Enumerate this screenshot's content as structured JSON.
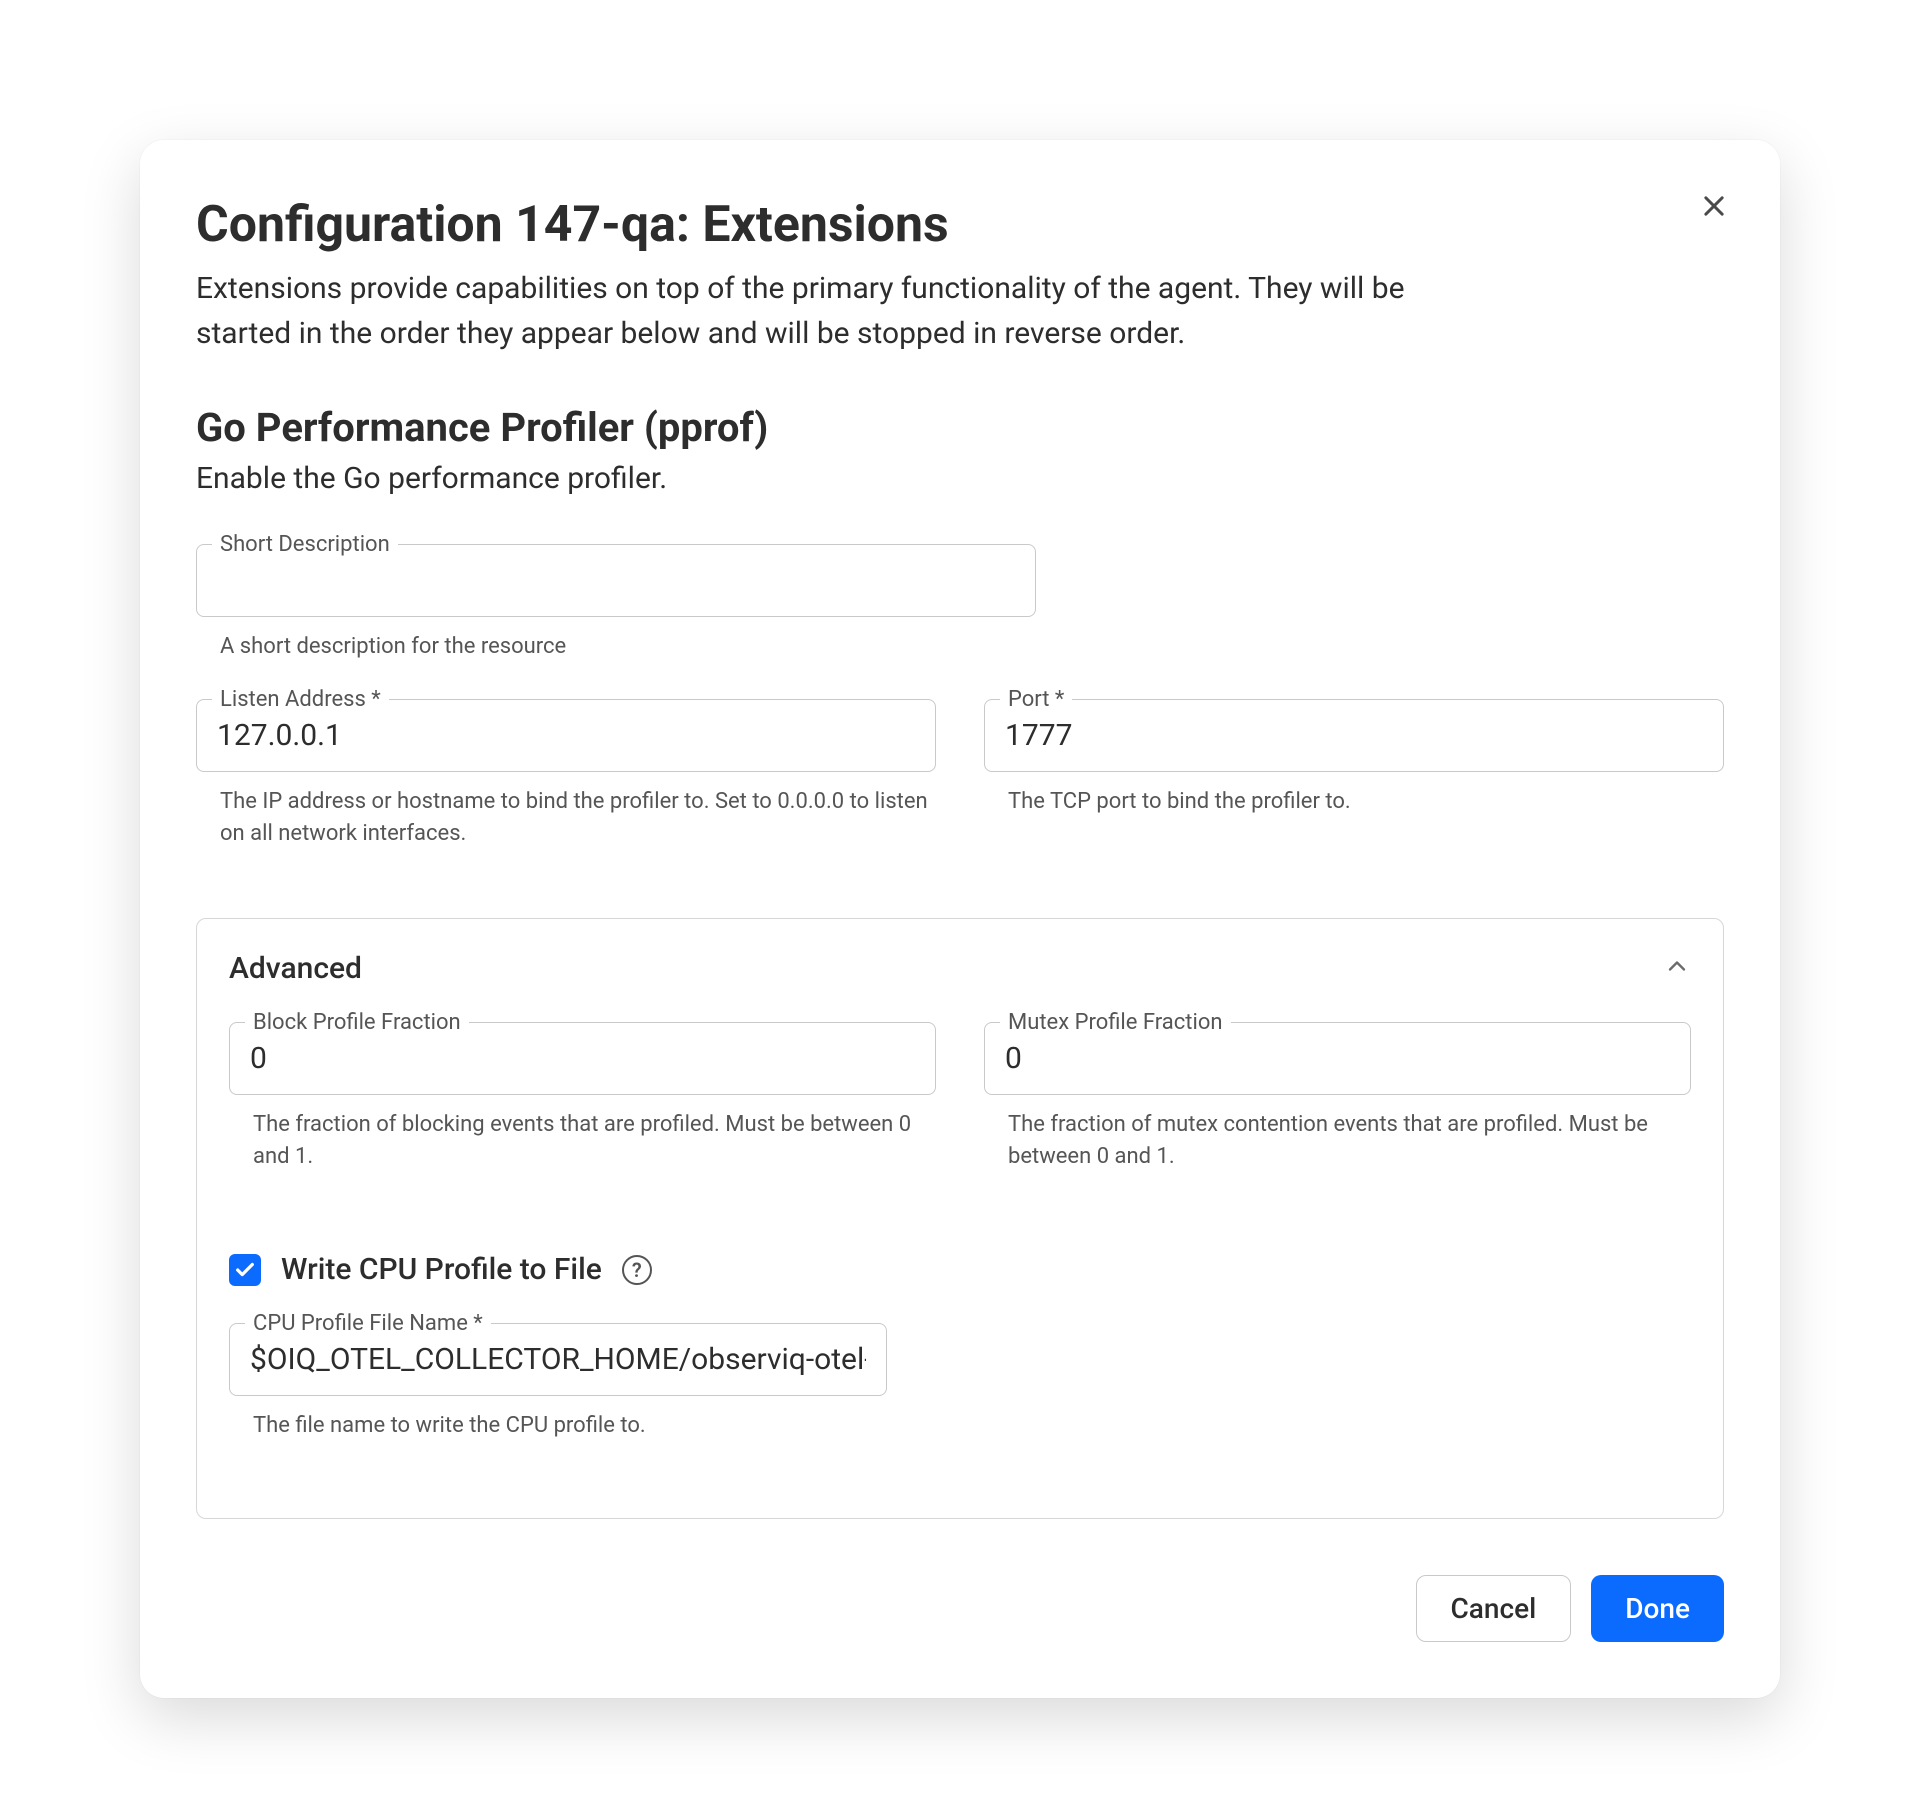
{
  "dialog": {
    "title": "Configuration 147-qa: Extensions",
    "subtitle": "Extensions provide capabilities on top of the primary functionality of the agent. They will be started in the order they appear below and will be stopped in reverse order."
  },
  "section": {
    "title": "Go Performance Profiler (pprof)",
    "desc": "Enable the Go performance profiler."
  },
  "fields": {
    "shortDescription": {
      "label": "Short Description",
      "value": "",
      "helper": "A short description for the resource"
    },
    "listenAddress": {
      "label": "Listen Address *",
      "value": "127.0.0.1",
      "helper": "The IP address or hostname to bind the profiler to. Set to 0.0.0.0 to listen on all network interfaces."
    },
    "port": {
      "label": "Port *",
      "value": "1777",
      "helper": "The TCP port to bind the profiler to."
    }
  },
  "advanced": {
    "title": "Advanced",
    "blockProfile": {
      "label": "Block Profile Fraction",
      "value": "0",
      "helper": "The fraction of blocking events that are profiled. Must be between 0 and 1."
    },
    "mutexProfile": {
      "label": "Mutex Profile Fraction",
      "value": "0",
      "helper": "The fraction of mutex contention events that are profiled. Must be between 0 and 1."
    },
    "writeCpuCheckbox": {
      "label": "Write CPU Profile to File",
      "checked": true
    },
    "cpuFile": {
      "label": "CPU Profile File Name *",
      "value": "$OIQ_OTEL_COLLECTOR_HOME/observiq-otel-col",
      "helper": "The file name to write the CPU profile to."
    }
  },
  "actions": {
    "cancel": "Cancel",
    "done": "Done"
  }
}
